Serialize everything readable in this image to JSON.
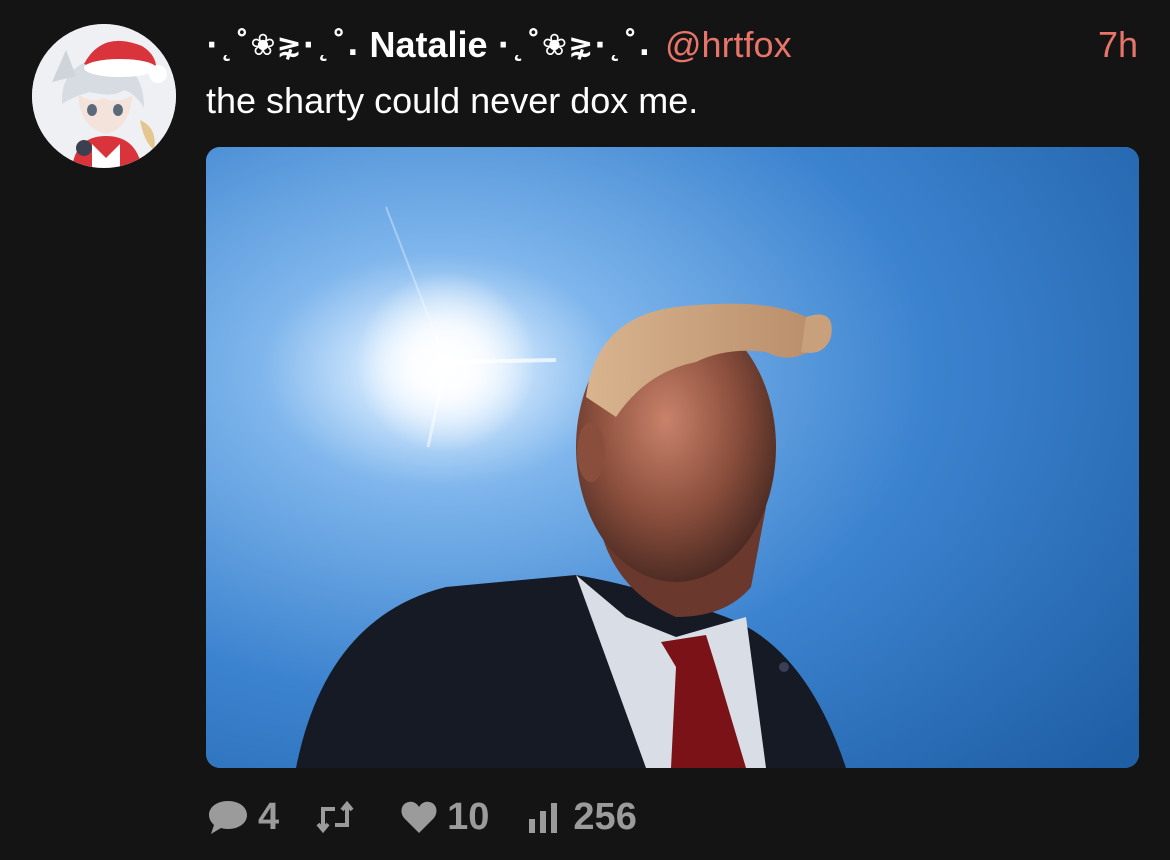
{
  "post": {
    "author": {
      "deco_left": "·˛˚❀⋧·˛˚.",
      "name": "Natalie",
      "deco_right": "·˛˚❀⋧·˛˚.",
      "handle": "@hrtfox"
    },
    "time": "7h",
    "text": "the sharty could never dox me.",
    "stats": {
      "replies": "4",
      "likes": "10",
      "views": "256"
    }
  },
  "icons": {
    "reply": "speech-bubble-icon",
    "repost": "repost-icon",
    "like": "heart-icon",
    "views": "bar-chart-icon"
  },
  "colors": {
    "background": "#141414",
    "text": "#ffffff",
    "accent": "#e8756a",
    "muted": "#9b9b9b"
  }
}
